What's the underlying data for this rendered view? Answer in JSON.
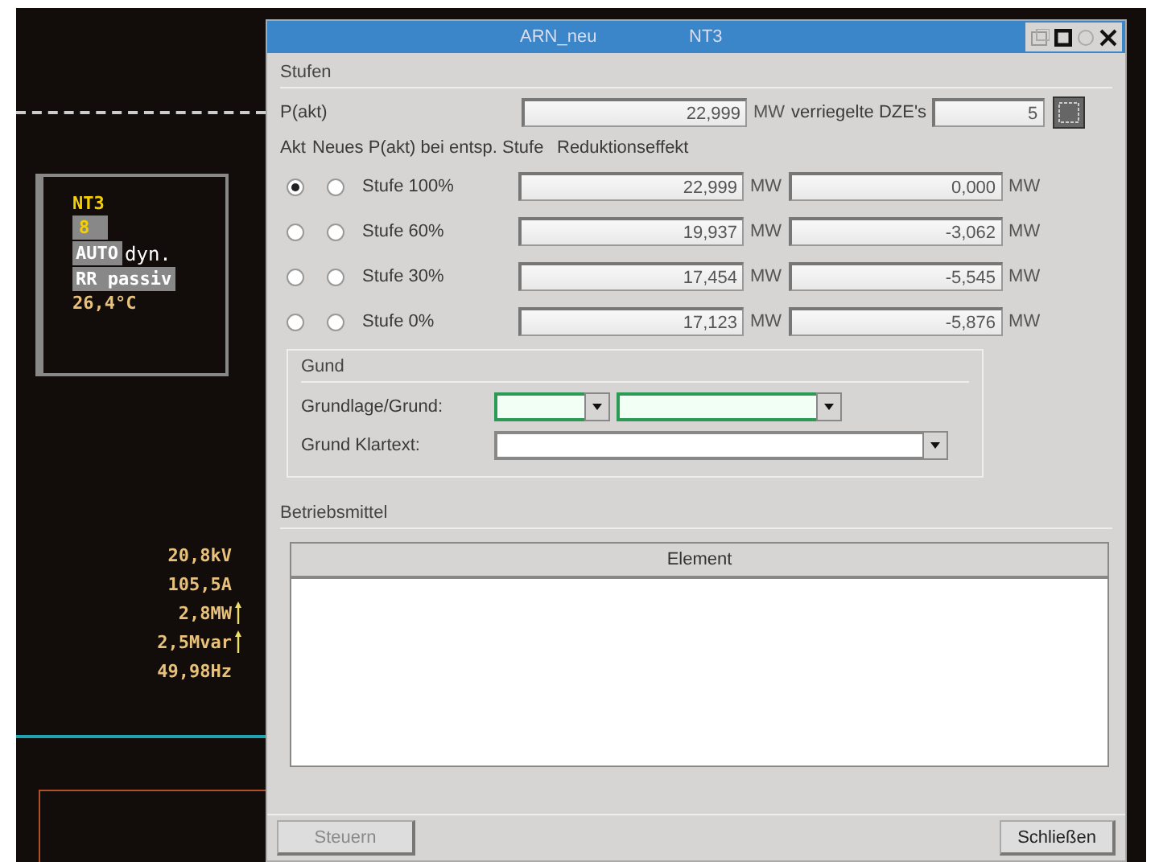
{
  "scada": {
    "station": {
      "name": "NT3",
      "badge": "8",
      "mode": "AUTO",
      "mode_detail": "dyn.",
      "status": "RR passiv",
      "temperature": "26,4°C"
    },
    "measurements": [
      {
        "text": "20,8kV",
        "kind": "plain"
      },
      {
        "text": "105,5A",
        "kind": "plain"
      },
      {
        "text": "2,8MW",
        "kind": "rising"
      },
      {
        "text": "2,5Mvar",
        "kind": "rising"
      },
      {
        "text": "49,98Hz",
        "kind": "plain"
      }
    ]
  },
  "dialog": {
    "title": "ARN_neu",
    "subtitle": "NT3",
    "stufen": {
      "legend": "Stufen",
      "p_akt": {
        "label": "P(akt)",
        "value": "22,999",
        "unit": "MW"
      },
      "dze": {
        "label": "verriegelte DZE's",
        "value": "5"
      },
      "header_akt": "Akt",
      "header_new": "Neues P(akt) bei entsp. Stufe",
      "header_reduction": "Reduktionseffekt",
      "steps": [
        {
          "label": "Stufe 100%",
          "akt_selected": true,
          "new_selected": false,
          "power": "22,999",
          "power_unit": "MW",
          "reduction": "0,000",
          "reduction_unit": "MW"
        },
        {
          "label": "Stufe 60%",
          "akt_selected": false,
          "new_selected": false,
          "power": "19,937",
          "power_unit": "MW",
          "reduction": "-3,062",
          "reduction_unit": "MW"
        },
        {
          "label": "Stufe 30%",
          "akt_selected": false,
          "new_selected": false,
          "power": "17,454",
          "power_unit": "MW",
          "reduction": "-5,545",
          "reduction_unit": "MW"
        },
        {
          "label": "Stufe 0%",
          "akt_selected": false,
          "new_selected": false,
          "power": "17,123",
          "power_unit": "MW",
          "reduction": "-5,876",
          "reduction_unit": "MW"
        }
      ]
    },
    "grund": {
      "legend": "Gund",
      "grundlage_label": "Grundlage/Grund:",
      "grundlage_highlighted": true,
      "klartext_label": "Grund Klartext:",
      "klartext_highlighted": false
    },
    "betriebsmittel": {
      "legend": "Betriebsmittel",
      "columns": [
        "Element"
      ]
    },
    "buttons": [
      {
        "label": "Steuern",
        "disabled": true
      },
      {
        "label": "Schließen",
        "disabled": false
      }
    ]
  }
}
